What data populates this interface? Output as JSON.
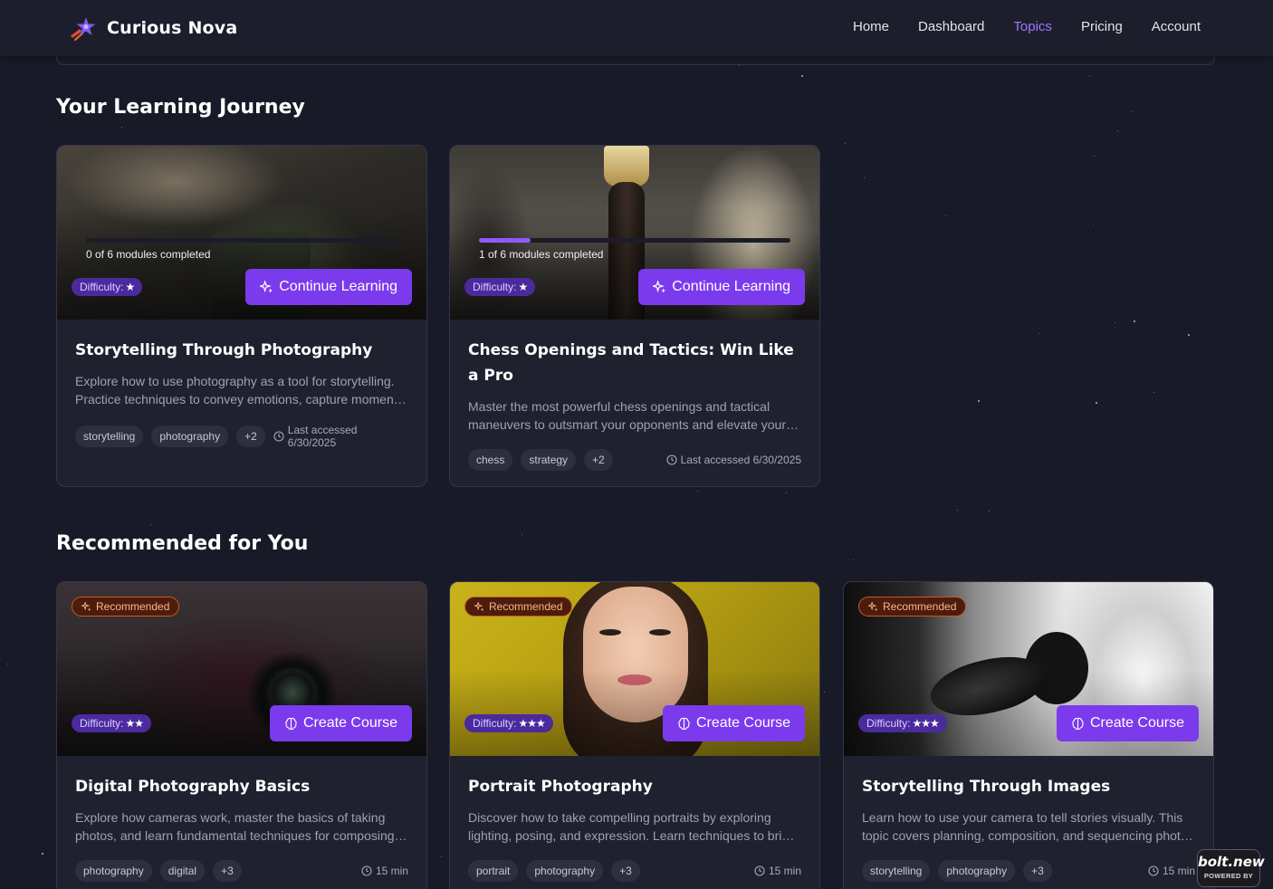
{
  "header": {
    "brand": "Curious Nova",
    "nav": [
      {
        "label": "Home",
        "active": false
      },
      {
        "label": "Dashboard",
        "active": false
      },
      {
        "label": "Topics",
        "active": true
      },
      {
        "label": "Pricing",
        "active": false
      },
      {
        "label": "Account",
        "active": false
      }
    ]
  },
  "journey": {
    "title": "Your Learning Journey",
    "cards": [
      {
        "image": "photography-still-life",
        "progress_text": "0 of 6 modules completed",
        "progress": 0,
        "difficulty_label": "Difficulty:",
        "difficulty_stars": "★",
        "action": "Continue Learning",
        "title": "Storytelling Through Photography",
        "description": "Explore how to use photography as a tool for storytelling. Practice techniques to convey emotions, capture moments, and build compelling visual narratives.",
        "tags": [
          "storytelling",
          "photography",
          "+2"
        ],
        "meta": "Last accessed 6/30/2025"
      },
      {
        "image": "chess-pieces",
        "progress_text": "1 of 6 modules completed",
        "progress": 0.1667,
        "difficulty_label": "Difficulty:",
        "difficulty_stars": "★",
        "action": "Continue Learning",
        "title": "Chess Openings and Tactics: Win Like a Pro",
        "description": "Master the most powerful chess openings and tactical maneuvers to outsmart your opponents and elevate your game.",
        "tags": [
          "chess",
          "strategy",
          "+2"
        ],
        "meta": "Last accessed 6/30/2025"
      }
    ]
  },
  "recommended": {
    "title": "Recommended for You",
    "badge": "Recommended",
    "cards": [
      {
        "image": "canon-camera",
        "difficulty_label": "Difficulty:",
        "difficulty_stars": "★★",
        "action": "Create Course",
        "title": "Digital Photography Basics",
        "description": "Explore how cameras work, master the basics of taking photos, and learn fundamental techniques for composing great shots.",
        "tags": [
          "photography",
          "digital",
          "+3"
        ],
        "meta": "15 min"
      },
      {
        "image": "portrait-woman",
        "difficulty_label": "Difficulty:",
        "difficulty_stars": "★★★",
        "action": "Create Course",
        "title": "Portrait Photography",
        "description": "Discover how to take compelling portraits by exploring lighting, posing, and expression. Learn techniques to bring out personality.",
        "tags": [
          "portrait",
          "photography",
          "+3"
        ],
        "meta": "15 min"
      },
      {
        "image": "reaching-hand",
        "difficulty_label": "Difficulty:",
        "difficulty_stars": "★★★",
        "action": "Create Course",
        "title": "Storytelling Through Images",
        "description": "Learn how to use your camera to tell stories visually. This topic covers planning, composition, and sequencing photos into narratives.",
        "tags": [
          "storytelling",
          "photography",
          "+3"
        ],
        "meta": "15 min"
      }
    ]
  },
  "footer_badge": {
    "logo": "bolt.new",
    "caption": "POWERED BY"
  }
}
